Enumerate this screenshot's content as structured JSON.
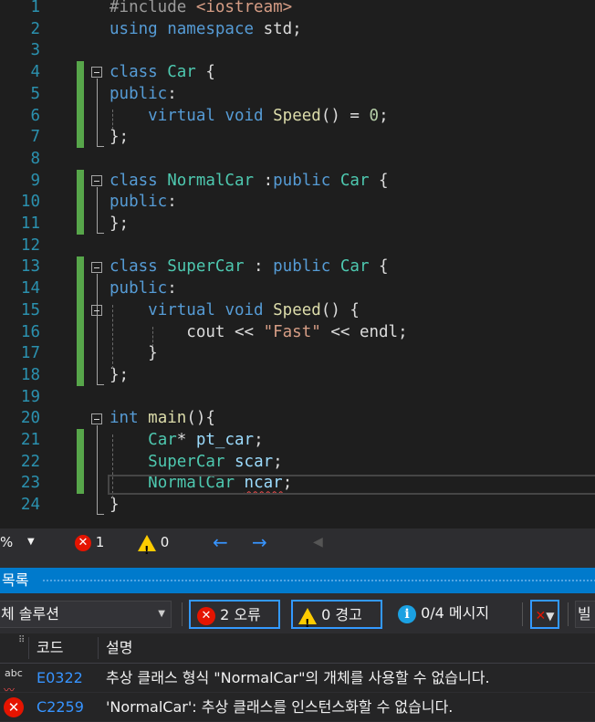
{
  "editor": {
    "lines": [
      {
        "n": "1",
        "segs": [
          [
            "pp",
            "#include "
          ],
          [
            "st",
            "<iostream>"
          ]
        ]
      },
      {
        "n": "2",
        "segs": [
          [
            "kw",
            "using "
          ],
          [
            "kw",
            "namespace "
          ],
          [
            "",
            "std;"
          ]
        ]
      },
      {
        "n": "3",
        "segs": []
      },
      {
        "n": "4",
        "segs": [
          [
            "kw",
            "class "
          ],
          [
            "ty",
            "Car"
          ],
          [
            "",
            " {"
          ]
        ]
      },
      {
        "n": "5",
        "segs": [
          [
            "kw",
            "public"
          ],
          [
            "",
            ":"
          ]
        ]
      },
      {
        "n": "6",
        "segs": [
          [
            "",
            "    "
          ],
          [
            "kw",
            "virtual "
          ],
          [
            "kw",
            "void "
          ],
          [
            "fn",
            "Speed"
          ],
          [
            "",
            "() = "
          ],
          [
            "nu",
            "0"
          ],
          [
            "",
            ";"
          ]
        ]
      },
      {
        "n": "7",
        "segs": [
          [
            "",
            "};"
          ]
        ]
      },
      {
        "n": "8",
        "segs": []
      },
      {
        "n": "9",
        "segs": [
          [
            "kw",
            "class "
          ],
          [
            "ty",
            "NormalCar"
          ],
          [
            "",
            " :"
          ],
          [
            "kw",
            "public "
          ],
          [
            "ty",
            "Car"
          ],
          [
            "",
            " {"
          ]
        ]
      },
      {
        "n": "10",
        "segs": [
          [
            "kw",
            "public"
          ],
          [
            "",
            ":"
          ]
        ]
      },
      {
        "n": "11",
        "segs": [
          [
            "",
            "};"
          ]
        ]
      },
      {
        "n": "12",
        "segs": []
      },
      {
        "n": "13",
        "segs": [
          [
            "kw",
            "class "
          ],
          [
            "ty",
            "SuperCar"
          ],
          [
            "",
            " : "
          ],
          [
            "kw",
            "public "
          ],
          [
            "ty",
            "Car"
          ],
          [
            "",
            " {"
          ]
        ]
      },
      {
        "n": "14",
        "segs": [
          [
            "kw",
            "public"
          ],
          [
            "",
            ":"
          ]
        ]
      },
      {
        "n": "15",
        "segs": [
          [
            "",
            "    "
          ],
          [
            "kw",
            "virtual "
          ],
          [
            "kw",
            "void "
          ],
          [
            "fn",
            "Speed"
          ],
          [
            "",
            "() {"
          ]
        ]
      },
      {
        "n": "16",
        "segs": [
          [
            "",
            "        cout << "
          ],
          [
            "st",
            "\"Fast\""
          ],
          [
            "",
            " << endl;"
          ]
        ]
      },
      {
        "n": "17",
        "segs": [
          [
            "",
            "    }"
          ]
        ]
      },
      {
        "n": "18",
        "segs": [
          [
            "",
            "};"
          ]
        ]
      },
      {
        "n": "19",
        "segs": []
      },
      {
        "n": "20",
        "segs": [
          [
            "kw",
            "int "
          ],
          [
            "fn",
            "main"
          ],
          [
            "",
            "(){"
          ]
        ]
      },
      {
        "n": "21",
        "segs": [
          [
            "",
            "    "
          ],
          [
            "ty",
            "Car"
          ],
          [
            "",
            "* "
          ],
          [
            "va",
            "pt_car"
          ],
          [
            "",
            ";"
          ]
        ]
      },
      {
        "n": "22",
        "segs": [
          [
            "",
            "    "
          ],
          [
            "ty",
            "SuperCar"
          ],
          [
            "",
            " "
          ],
          [
            "va",
            "scar"
          ],
          [
            "",
            ";"
          ]
        ]
      },
      {
        "n": "23",
        "segs": [
          [
            "",
            "    "
          ],
          [
            "ty",
            "NormalCar"
          ],
          [
            "",
            " "
          ],
          [
            "va squig",
            "ncar"
          ],
          [
            "",
            ";"
          ]
        ]
      },
      {
        "n": "24",
        "segs": [
          [
            "",
            "}"
          ]
        ]
      }
    ]
  },
  "statusbar": {
    "zoom_fragment": "%",
    "error_count": "1",
    "warning_count": "0",
    "back_arrow": "←",
    "forward_arrow": "→"
  },
  "error_list": {
    "title": "목록",
    "scope": "체 솔루션",
    "errors_btn": "2 오류",
    "warnings_btn": "0 경고",
    "messages_btn": "0/4 메시지",
    "build_fragment": "빌",
    "columns": {
      "code": "코드",
      "description": "설명"
    },
    "rows": [
      {
        "code": "E0322",
        "description": "추상 클래스 형식 \"NormalCar\"의 개체를 사용할 수 없습니다.",
        "icon": "spell-squiggle-icon"
      },
      {
        "code": "C2259",
        "description": "'NormalCar': 추상 클래스를 인스턴스화할 수 없습니다.",
        "icon": "error-icon"
      }
    ]
  },
  "colors": {
    "accent": "#007acc",
    "error": "#e51400",
    "warning": "#ffcc00",
    "info": "#1ba1e2",
    "gutter_changed": "#57a64a"
  }
}
